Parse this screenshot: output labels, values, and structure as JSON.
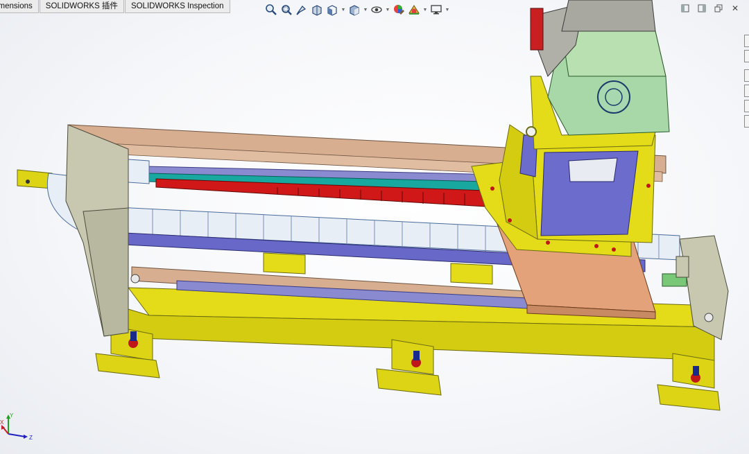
{
  "tabs": [
    {
      "label": "imensions",
      "name": "tab-dimensions"
    },
    {
      "label": "SOLIDWORKS 插件",
      "name": "tab-solidworks-addins"
    },
    {
      "label": "SOLIDWORKS Inspection",
      "name": "tab-solidworks-inspection"
    }
  ],
  "heads_up_toolbar": [
    {
      "name": "zoom-to-fit-icon"
    },
    {
      "name": "zoom-to-area-icon"
    },
    {
      "name": "previous-view-icon"
    },
    {
      "name": "section-view-icon"
    },
    {
      "name": "view-orientation-icon",
      "dropdown": true
    },
    {
      "name": "display-style-icon",
      "dropdown": true
    },
    {
      "name": "hide-show-items-icon",
      "dropdown": true
    },
    {
      "name": "edit-appearance-icon"
    },
    {
      "name": "apply-scene-icon",
      "dropdown": true
    },
    {
      "name": "view-settings-icon",
      "dropdown": true
    }
  ],
  "window_controls": [
    {
      "name": "tile-left-icon"
    },
    {
      "name": "tile-right-icon"
    },
    {
      "name": "restore-window-icon"
    },
    {
      "name": "close-window-icon",
      "glyph": "✕"
    }
  ],
  "triad": {
    "x_label": "X",
    "y_label": "Y",
    "z_label": "Z"
  },
  "colors": {
    "frame_yellow": "#dcd40f",
    "plate_tan": "#d8a886",
    "motor_green": "#a8d8a8",
    "rail_purple": "#6868c8",
    "chain_white": "#e8eef6",
    "rack_teal": "#18a8a0",
    "rack_red": "#d01818",
    "carriage_orange": "#e8a070",
    "side_plate_gray": "#c8c8b4"
  }
}
